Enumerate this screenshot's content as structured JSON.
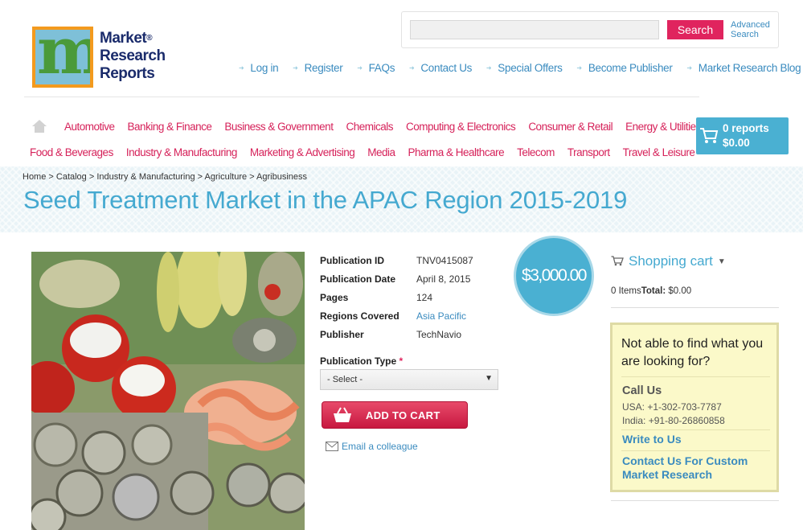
{
  "logo": {
    "line1": "Market",
    "line2": "Research",
    "line3": "Reports",
    "registered": "®",
    "letter": "m"
  },
  "search": {
    "placeholder": "",
    "button_label": "Search",
    "advanced_label": "Advanced Search"
  },
  "top_nav": [
    "Log in",
    "Register",
    "FAQs",
    "Contact Us",
    "Special Offers",
    "Become Publisher",
    "Market Research Blog"
  ],
  "categories_row1": [
    "Automotive",
    "Banking & Finance",
    "Business & Government",
    "Chemicals",
    "Computing & Electronics",
    "Consumer & Retail",
    "Energy & Utilities"
  ],
  "categories_row2": [
    "Food & Beverages",
    "Industry & Manufacturing",
    "Marketing & Advertising",
    "Media",
    "Pharma & Healthcare",
    "Telecom",
    "Transport",
    "Travel & Leisure"
  ],
  "header_cart": {
    "count": "0 reports",
    "amount": "$0.00"
  },
  "breadcrumb": "Home > Catalog > Industry & Manufacturing > Agriculture > Agribusiness",
  "page_title": "Seed Treatment Market in the APAC Region 2015-2019",
  "details": [
    {
      "label": "Publication ID",
      "value": "TNV0415087"
    },
    {
      "label": "Publication Date",
      "value": "April 8, 2015"
    },
    {
      "label": "Pages",
      "value": "124"
    },
    {
      "label": "Regions Covered",
      "value": "Asia Pacific"
    },
    {
      "label": "Publisher",
      "value": "TechNavio"
    }
  ],
  "price": "$3,000.00",
  "publication_type": {
    "label": "Publication Type",
    "required": "*",
    "selected": "- Select -"
  },
  "add_to_cart_label": "ADD TO CART",
  "email_colleague_label": "Email a colleague",
  "sidebar": {
    "title": "Shopping cart",
    "items_text": "0 Items",
    "total_label": "Total:",
    "total_value": "$0.00",
    "help_question": "Not able to find what you are looking for?",
    "call_us": "Call Us",
    "phone_usa": "USA: +1-302-703-7787",
    "phone_india": "India: +91-80-26860858",
    "write_to_us": "Write to Us",
    "custom_research": "Contact Us For Custom Market Research"
  },
  "colors": {
    "accent_blue": "#45a9d0",
    "accent_pink": "#d6225a",
    "button_red": "#c81840",
    "help_bg": "#fbf9c9"
  }
}
